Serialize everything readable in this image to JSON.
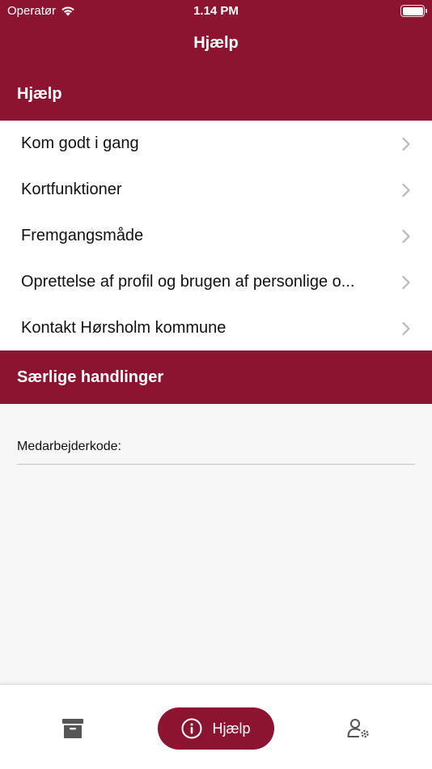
{
  "status_bar": {
    "carrier": "Operatør",
    "time": "1.14 PM"
  },
  "header": {
    "title": "Hjælp"
  },
  "help_section": {
    "title": "Hjælp",
    "items": [
      {
        "label": "Kom godt i gang"
      },
      {
        "label": "Kortfunktioner"
      },
      {
        "label": "Fremgangsmåde"
      },
      {
        "label": "Oprettelse af profil og brugen af personlige o..."
      },
      {
        "label": "Kontakt Hørsholm kommune"
      }
    ]
  },
  "special_section": {
    "title": "Særlige handlinger",
    "employee_code_label": "Medarbejderkode:",
    "employee_code_value": ""
  },
  "tab_bar": {
    "active_tab": "Hjælp",
    "tabs": [
      {
        "icon": "archive-icon"
      },
      {
        "icon": "info-icon",
        "label": "Hjælp"
      },
      {
        "icon": "user-settings-icon"
      }
    ]
  },
  "colors": {
    "brand": "#8b1530",
    "background": "#f7f7f7",
    "chevron": "#b8b8bd",
    "tab_icon": "#555555"
  }
}
